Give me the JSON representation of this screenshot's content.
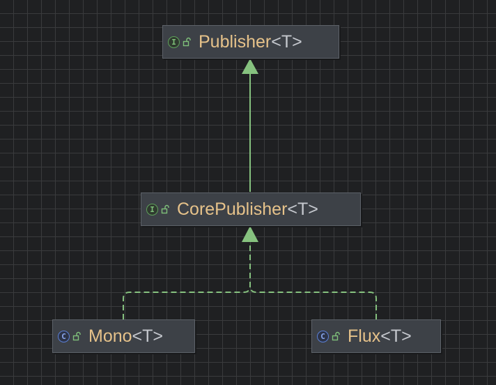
{
  "colors": {
    "background": "#1f2022",
    "grid": "#3a3b3d",
    "node_fill": "#3d4147",
    "node_border": "#5d6269",
    "class_name": "#e6c28a",
    "generic_param": "#c5c8ce",
    "edge": "#86c27f",
    "interface_icon": "#5fa15b",
    "class_icon": "#5a7fd6"
  },
  "nodes": [
    {
      "id": "publisher",
      "kind": "interface",
      "kind_icon_letter": "I",
      "visibility_icon": "public-lock-icon",
      "name": "Publisher",
      "generic": "<T>"
    },
    {
      "id": "corepublisher",
      "kind": "interface",
      "kind_icon_letter": "I",
      "visibility_icon": "public-lock-icon",
      "name": "CorePublisher",
      "generic": "<T>"
    },
    {
      "id": "mono",
      "kind": "class",
      "kind_icon_letter": "C",
      "visibility_icon": "public-lock-icon",
      "name": "Mono",
      "generic": "<T>"
    },
    {
      "id": "flux",
      "kind": "class",
      "kind_icon_letter": "C",
      "visibility_icon": "public-lock-icon",
      "name": "Flux",
      "generic": "<T>"
    }
  ],
  "edges": [
    {
      "from": "corepublisher",
      "to": "publisher",
      "relation": "extends",
      "style": "solid"
    },
    {
      "from": "mono",
      "to": "corepublisher",
      "relation": "implements",
      "style": "dashed"
    },
    {
      "from": "flux",
      "to": "corepublisher",
      "relation": "implements",
      "style": "dashed"
    }
  ]
}
